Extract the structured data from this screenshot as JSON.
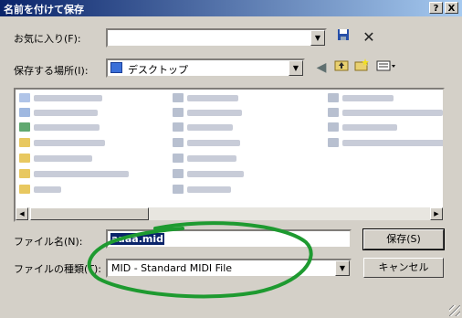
{
  "window": {
    "title": "名前を付けて保存",
    "help_button": "?",
    "close_button": "X"
  },
  "favorites": {
    "label": "お気に入り(F):",
    "value": ""
  },
  "save_in": {
    "label": "保存する場所(I):",
    "value": "デスクトップ"
  },
  "file_name": {
    "label": "ファイル名(N):",
    "value": "aaaa.mid"
  },
  "file_type": {
    "label": "ファイルの種類(T):",
    "value": "MID - Standard MIDI File"
  },
  "buttons": {
    "save": "保存(S)",
    "cancel": "キャンセル"
  },
  "icons": {
    "save_favorite": "floppy-icon",
    "delete_favorite": "x-icon",
    "desktop": "desktop-icon",
    "back": "back-arrow-icon",
    "up_folder": "up-folder-icon",
    "new_folder": "new-folder-icon",
    "view_menu": "view-menu-icon"
  },
  "colors": {
    "title_start": "#0a246a",
    "title_end": "#a6caf0",
    "annotation_circle": "#1e9a30"
  }
}
